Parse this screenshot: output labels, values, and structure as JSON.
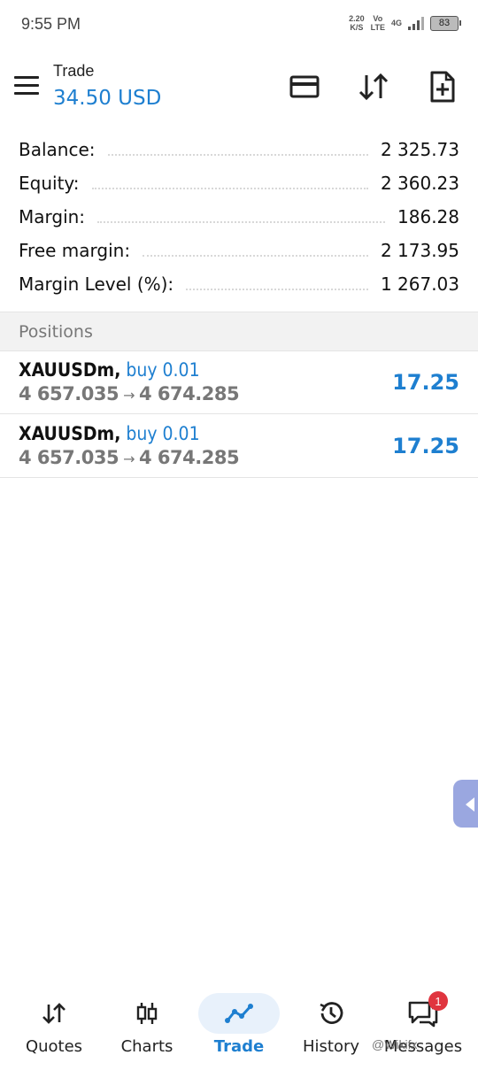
{
  "status_bar": {
    "time": "9:55 PM",
    "net_speed_value": "2.20",
    "net_speed_unit": "K/S",
    "volte_top": "Vo",
    "volte_bottom": "LTE",
    "network": "4G",
    "battery": "83"
  },
  "header": {
    "title": "Trade",
    "balance": "34.50 USD"
  },
  "summary": [
    {
      "label": "Balance:",
      "value": "2 325.73"
    },
    {
      "label": "Equity:",
      "value": "2 360.23"
    },
    {
      "label": "Margin:",
      "value": "186.28"
    },
    {
      "label": "Free margin:",
      "value": "2 173.95"
    },
    {
      "label": "Margin Level (%):",
      "value": "1 267.03"
    }
  ],
  "positions_header": "Positions",
  "positions": [
    {
      "symbol": "XAUUSDm,",
      "type": "buy 0.01",
      "open_price": "4 657.035",
      "arrow": "→",
      "current_price": "4 674.285",
      "profit": "17.25"
    },
    {
      "symbol": "XAUUSDm,",
      "type": "buy 0.01",
      "open_price": "4 657.035",
      "arrow": "→",
      "current_price": "4 674.285",
      "profit": "17.25"
    }
  ],
  "nav": {
    "items": [
      {
        "label": "Quotes",
        "icon": "quotes-arrows-icon"
      },
      {
        "label": "Charts",
        "icon": "candlestick-icon"
      },
      {
        "label": "Trade",
        "icon": "trade-line-icon"
      },
      {
        "label": "History",
        "icon": "history-clock-icon"
      },
      {
        "label": "Messages",
        "icon": "messages-chat-icon",
        "badge": "1"
      }
    ],
    "active": "Trade"
  },
  "watermark": "@Wikifx",
  "colors": {
    "accent": "#1e7fd0",
    "badge": "#e0353f",
    "side_tab": "#9aa7e0"
  }
}
